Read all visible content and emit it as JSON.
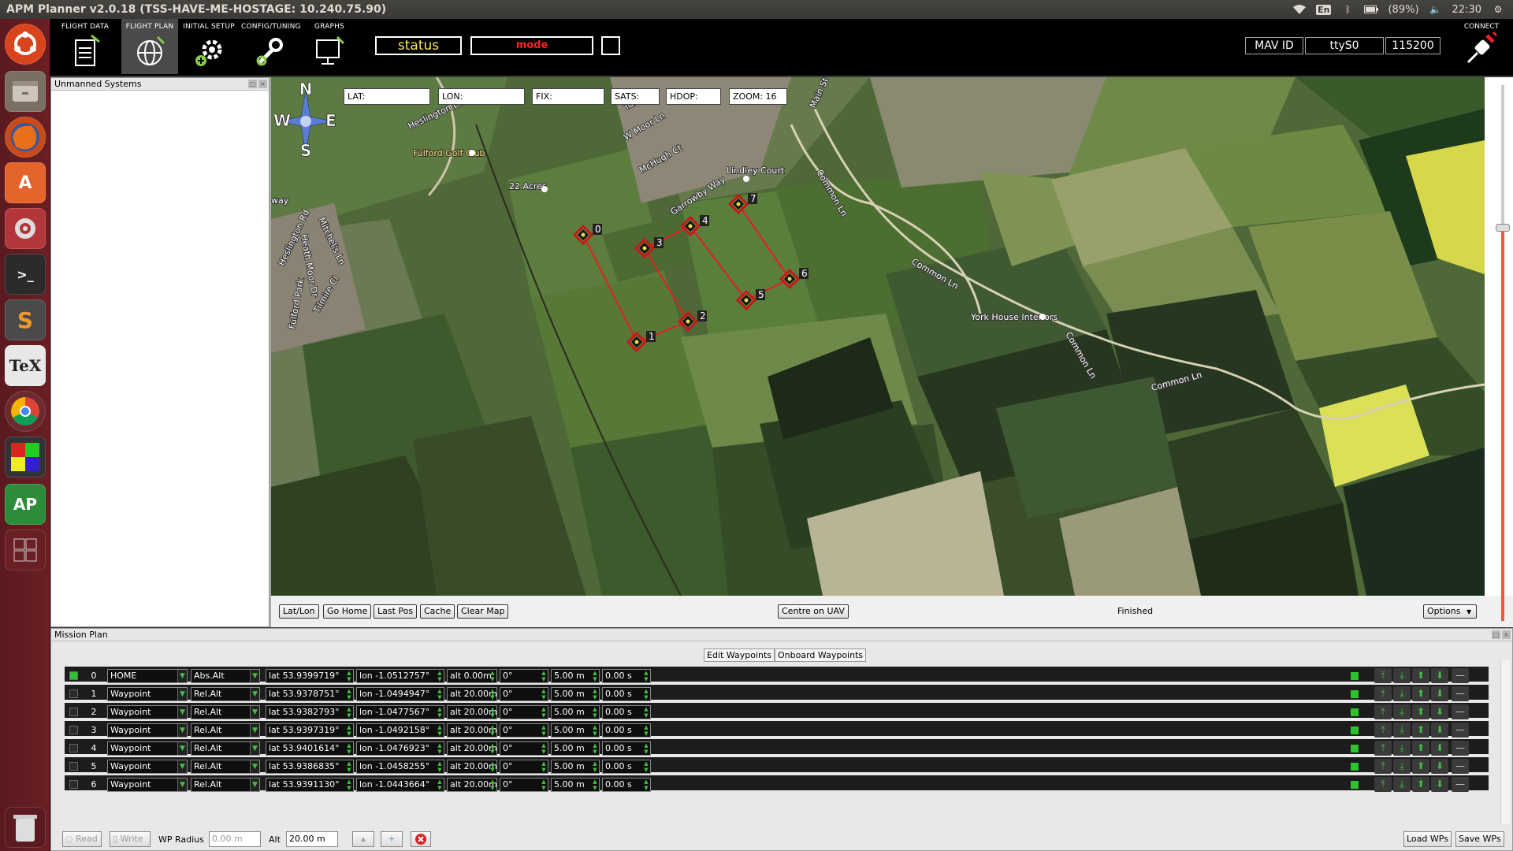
{
  "window": {
    "title": "APM Planner v2.0.18 (TSS-HAVE-ME-HOSTAGE: 10.240.75.90)"
  },
  "tray": {
    "lang": "En",
    "battery": "(89%)",
    "time": "22:30"
  },
  "toolbar": {
    "buttons": [
      {
        "label": "FLIGHT DATA"
      },
      {
        "label": "FLIGHT PLAN"
      },
      {
        "label": "INITIAL SETUP"
      },
      {
        "label": "CONFIG/TUNING"
      },
      {
        "label": "GRAPHS"
      }
    ],
    "status": "status",
    "mode": "mode",
    "mav_id": "MAV ID",
    "port": "ttyS0",
    "baud": "115200",
    "connect_label": "CONNECT"
  },
  "unmanned_panel": {
    "title": "Unmanned Systems"
  },
  "map": {
    "fields": {
      "lat": "LAT:",
      "lon": "LON:",
      "fix": "FIX:",
      "sats": "SATS:",
      "hdop": "HDOP:",
      "zoom": "ZOOM: 16"
    },
    "compass": {
      "n": "N",
      "s": "S",
      "e": "E",
      "w": "W"
    },
    "place_labels": [
      "Heslington Ln",
      "Fulford Golf Club",
      "22 Acres",
      "McHugh Ct",
      "W Moor Ln",
      "Turner",
      "Lindley Court",
      "Garrowby Way",
      "Main St",
      "Common Ln",
      "Common Ln",
      "York House Interiors",
      "Common Ln",
      "Common Ln",
      "Mitchel's Ln",
      "Heath Moor Dr",
      "Fulford Park",
      "Heslington Rd",
      "Tilmire Cl",
      "way"
    ],
    "markers": [
      "0",
      "1",
      "2",
      "3",
      "4",
      "5",
      "6",
      "7"
    ],
    "footer": {
      "buttons": [
        "Lat/Lon",
        "Go Home",
        "Last Pos",
        "Cache",
        "Clear Map"
      ],
      "centre": "Centre on UAV",
      "status": "Finished",
      "options": "Options"
    },
    "colors": {
      "route": "#e02020",
      "marker": "#c81818"
    }
  },
  "mission": {
    "title": "Mission Plan",
    "tabs": [
      "Edit Waypoints",
      "Onboard Waypoints"
    ],
    "rows": [
      {
        "idx": "0",
        "type": "HOME",
        "frame": "Abs.Alt",
        "lat": "lat 53.9399719°",
        "lon": "lon -1.0512757°",
        "alt": "alt 0.00m",
        "heading": "0°",
        "radius": "5.00 m",
        "delay": "0.00 s",
        "checked": true
      },
      {
        "idx": "1",
        "type": "Waypoint",
        "frame": "Rel.Alt",
        "lat": "lat 53.9378751°",
        "lon": "lon -1.0494947°",
        "alt": "alt 20.00m",
        "heading": "0°",
        "radius": "5.00 m",
        "delay": "0.00 s",
        "checked": false
      },
      {
        "idx": "2",
        "type": "Waypoint",
        "frame": "Rel.Alt",
        "lat": "lat 53.9382793°",
        "lon": "lon -1.0477567°",
        "alt": "alt 20.00m",
        "heading": "0°",
        "radius": "5.00 m",
        "delay": "0.00 s",
        "checked": false
      },
      {
        "idx": "3",
        "type": "Waypoint",
        "frame": "Rel.Alt",
        "lat": "lat 53.9397319°",
        "lon": "lon -1.0492158°",
        "alt": "alt 20.00m",
        "heading": "0°",
        "radius": "5.00 m",
        "delay": "0.00 s",
        "checked": false
      },
      {
        "idx": "4",
        "type": "Waypoint",
        "frame": "Rel.Alt",
        "lat": "lat 53.9401614°",
        "lon": "lon -1.0476923°",
        "alt": "alt 20.00m",
        "heading": "0°",
        "radius": "5.00 m",
        "delay": "0.00 s",
        "checked": false
      },
      {
        "idx": "5",
        "type": "Waypoint",
        "frame": "Rel.Alt",
        "lat": "lat 53.9386835°",
        "lon": "lon -1.0458255°",
        "alt": "alt 20.00m",
        "heading": "0°",
        "radius": "5.00 m",
        "delay": "0.00 s",
        "checked": false
      },
      {
        "idx": "6",
        "type": "Waypoint",
        "frame": "Rel.Alt",
        "lat": "lat 53.9391130°",
        "lon": "lon -1.0443664°",
        "alt": "alt 20.00m",
        "heading": "0°",
        "radius": "5.00 m",
        "delay": "0.00 s",
        "checked": false
      }
    ],
    "bottom": {
      "read": "Read",
      "write": "Write",
      "wp_radius_label": "WP Radius",
      "wp_radius_value": "0.00 m",
      "alt_label": "Alt",
      "alt_value": "20.00 m",
      "load": "Load WPs",
      "save": "Save WPs"
    }
  }
}
